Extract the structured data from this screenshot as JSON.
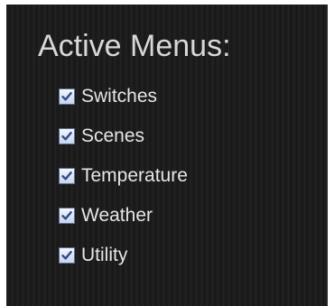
{
  "title": "Active Menus:",
  "menus": [
    {
      "label": "Switches",
      "checked": true
    },
    {
      "label": "Scenes",
      "checked": true
    },
    {
      "label": "Temperature",
      "checked": true
    },
    {
      "label": "Weather",
      "checked": true
    },
    {
      "label": "Utility",
      "checked": true
    }
  ],
  "colors": {
    "background": "#1c1c1c",
    "text": "#e6e6e6",
    "checkmark": "#2f4c8c"
  }
}
